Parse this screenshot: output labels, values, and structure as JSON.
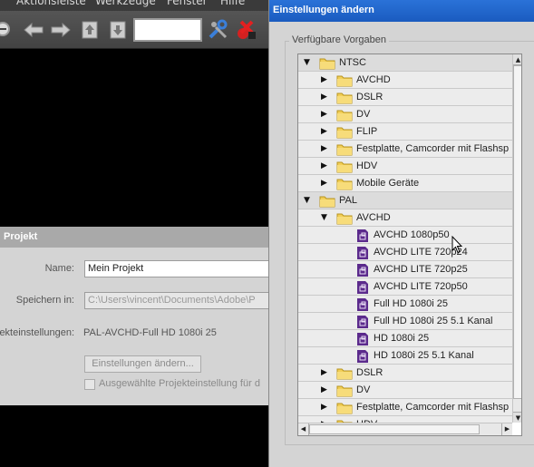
{
  "menubar": {
    "items": [
      "Aktionsleiste",
      "Werkzeuge",
      "Fenster",
      "Hilfe"
    ]
  },
  "toolbar": {
    "icons": [
      "zoom-out-icon",
      "back-arrow-icon",
      "forward-arrow-icon",
      "import-up-icon",
      "import-down-icon",
      "tools-icon",
      "exit-icon"
    ],
    "search_value": ""
  },
  "project": {
    "title": "Projekt",
    "name_label": "Name:",
    "name_value": "Mein Projekt",
    "save_label": "Speichern in:",
    "save_value": "C:\\Users\\vincent\\Documents\\Adobe\\P",
    "settings_label": "ekteinstellungen:",
    "settings_value": "PAL-AVCHD-Full HD 1080i 25",
    "change_button": "Einstellungen ändern...",
    "apply_checkbox_label": "Ausgewählte Projekteinstellung für d"
  },
  "dialog": {
    "title": "Einstellungen ändern",
    "presets_label": "Verfügbare Vorgaben",
    "tree": [
      {
        "level": 0,
        "expanded": true,
        "type": "folder",
        "label": "NTSC"
      },
      {
        "level": 1,
        "expanded": false,
        "type": "folder",
        "label": "AVCHD"
      },
      {
        "level": 1,
        "expanded": false,
        "type": "folder",
        "label": "DSLR"
      },
      {
        "level": 1,
        "expanded": false,
        "type": "folder",
        "label": "DV"
      },
      {
        "level": 1,
        "expanded": false,
        "type": "folder",
        "label": "FLIP"
      },
      {
        "level": 1,
        "expanded": false,
        "type": "folder",
        "label": "Festplatte, Camcorder mit Flashsp"
      },
      {
        "level": 1,
        "expanded": false,
        "type": "folder",
        "label": "HDV"
      },
      {
        "level": 1,
        "expanded": false,
        "type": "folder",
        "label": "Mobile Geräte"
      },
      {
        "level": 0,
        "expanded": true,
        "type": "folder",
        "label": "PAL"
      },
      {
        "level": 1,
        "expanded": true,
        "type": "folder",
        "label": "AVCHD"
      },
      {
        "level": 2,
        "type": "file",
        "label": "AVCHD 1080p50"
      },
      {
        "level": 2,
        "type": "file",
        "label": "AVCHD LITE 720p24"
      },
      {
        "level": 2,
        "type": "file",
        "label": "AVCHD LITE 720p25"
      },
      {
        "level": 2,
        "type": "file",
        "label": "AVCHD LITE 720p50"
      },
      {
        "level": 2,
        "type": "file",
        "label": "Full HD 1080i 25"
      },
      {
        "level": 2,
        "type": "file",
        "label": "Full HD 1080i 25 5.1 Kanal"
      },
      {
        "level": 2,
        "type": "file",
        "label": "HD 1080i 25"
      },
      {
        "level": 2,
        "type": "file",
        "label": "HD 1080i 25 5.1 Kanal"
      },
      {
        "level": 1,
        "expanded": false,
        "type": "folder",
        "label": "DSLR"
      },
      {
        "level": 1,
        "expanded": false,
        "type": "folder",
        "label": "DV"
      },
      {
        "level": 1,
        "expanded": false,
        "type": "folder",
        "label": "Festplatte, Camcorder mit Flashsp"
      },
      {
        "level": 1,
        "expanded": false,
        "type": "folder",
        "label": "HDV"
      }
    ]
  },
  "colors": {
    "titlebar_blue": "#1f6ad3",
    "folder_yellow": "#f2cf58",
    "preset_purple": "#5b2a8c"
  }
}
